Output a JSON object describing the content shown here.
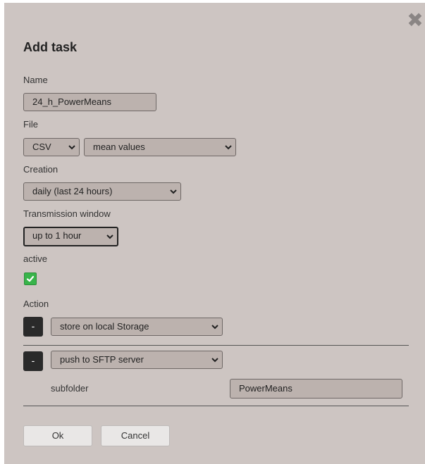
{
  "dialog": {
    "title": "Add task",
    "close_icon": "close-x-icon"
  },
  "form": {
    "name_label": "Name",
    "name_value": "24_h_PowerMeans",
    "file_label": "File",
    "file_format": "CSV",
    "file_content": "mean values",
    "creation_label": "Creation",
    "creation_value": "daily (last 24 hours)",
    "transmission_label": "Transmission window",
    "transmission_value": "up to 1 hour",
    "active_label": "active",
    "active_checked": true,
    "action_label": "Action"
  },
  "actions": [
    {
      "remove_label": "-",
      "type": "store on local Storage"
    },
    {
      "remove_label": "-",
      "type": "push to SFTP server",
      "subfolder_label": "subfolder",
      "subfolder_value": "PowerMeans"
    }
  ],
  "buttons": {
    "ok": "Ok",
    "cancel": "Cancel"
  },
  "colors": {
    "background": "#cdc5c2",
    "field": "#bcb2ae",
    "checkbox": "#38b44a",
    "remove_button": "#2a2a2a"
  }
}
